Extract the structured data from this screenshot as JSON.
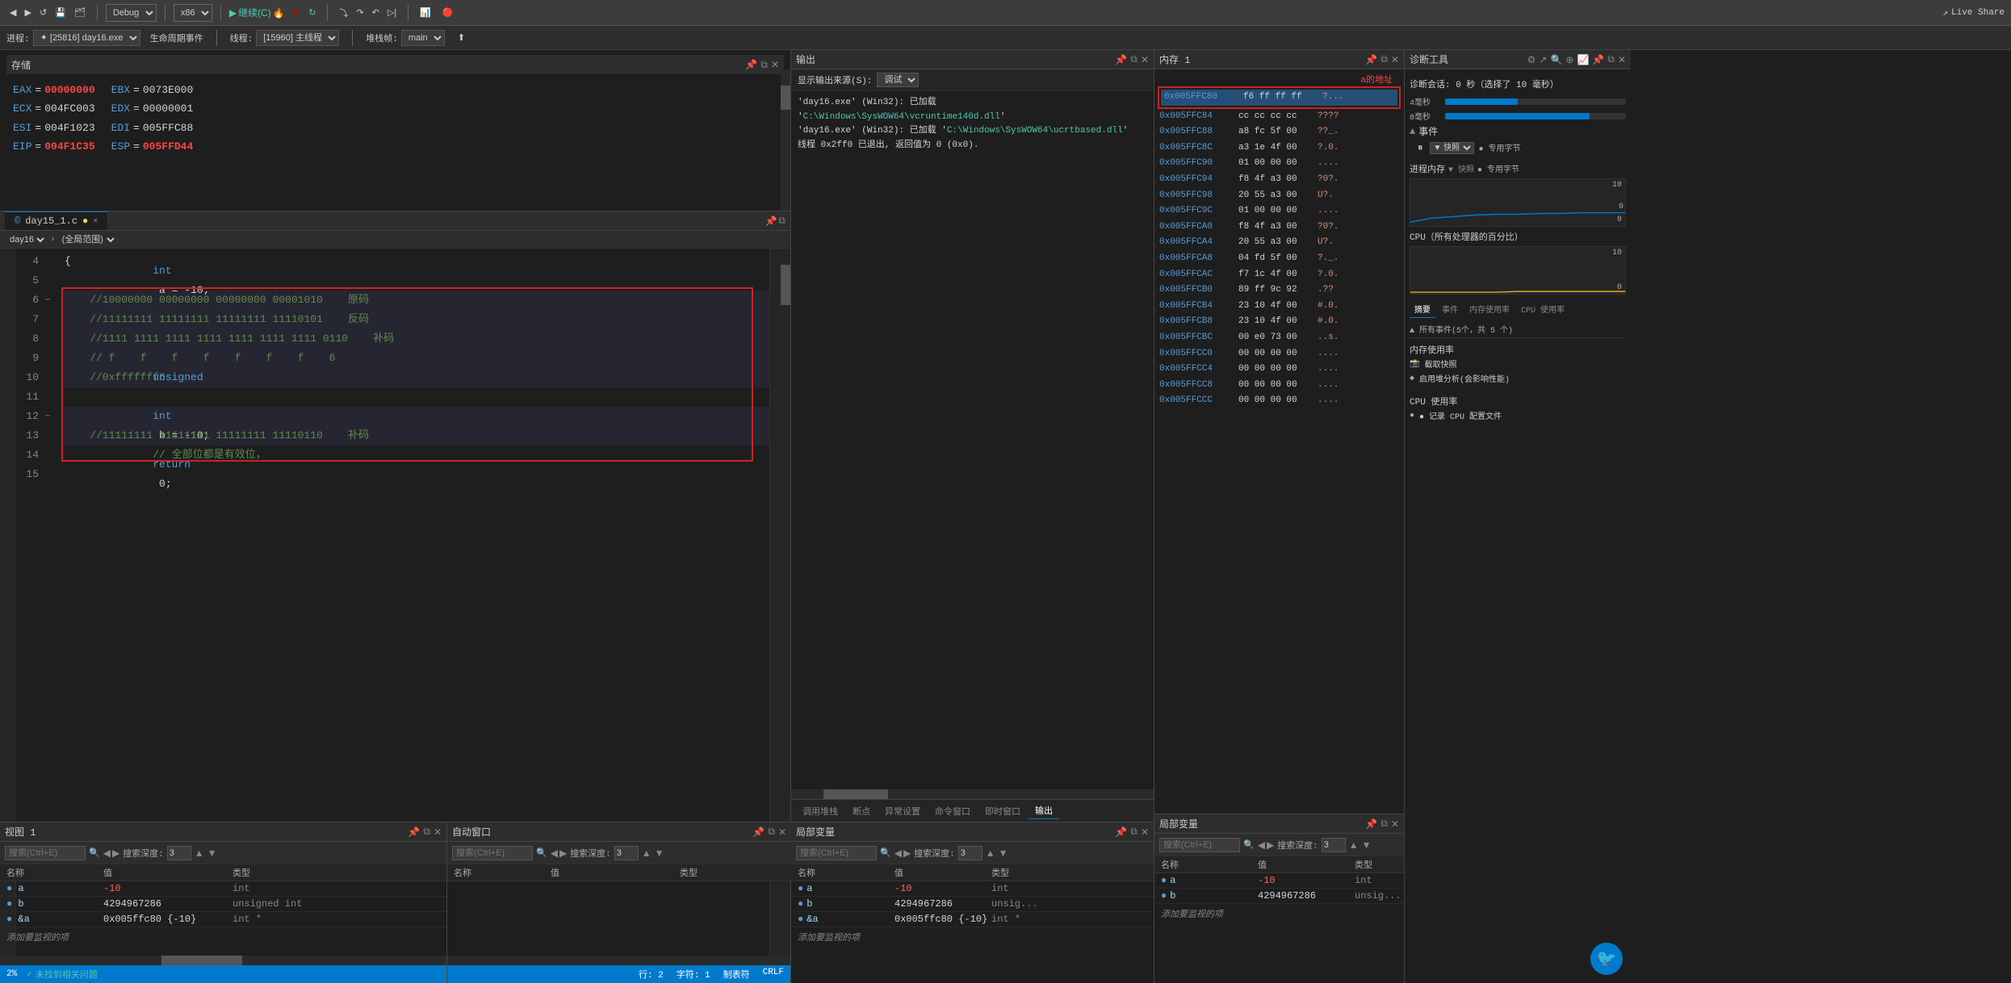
{
  "toolbar": {
    "debug_config": "Debug",
    "platform": "x86",
    "continue_label": "继续(C)",
    "live_share": "Live Share",
    "process_label": "进程:",
    "process_value": "[25816] day16.exe",
    "lifecycle_label": "生命周期事件",
    "thread_label": "线程:",
    "thread_value": "[15960] 主线程",
    "stack_label": "堆栈帧:",
    "stack_value": "main"
  },
  "registers_panel": {
    "title": "存储",
    "regs": [
      {
        "name": "EAX",
        "sep": "=",
        "value": "00000000",
        "highlight": true
      },
      {
        "name": "EBX",
        "sep": "=",
        "value": "0073E000"
      },
      {
        "name": "ECX",
        "sep": "=",
        "value": "004FC003"
      },
      {
        "name": "EDX",
        "sep": "=",
        "value": "00000001"
      },
      {
        "name": "ESI",
        "sep": "=",
        "value": "004F1023"
      },
      {
        "name": "EDI",
        "sep": "=",
        "value": "005FFC88"
      },
      {
        "name": "EIP",
        "sep": "=",
        "value": "004F1C35",
        "partial": true
      },
      {
        "name": "ESP",
        "sep": "=",
        "value": "005FFD44",
        "partial": true
      }
    ]
  },
  "editor": {
    "tab_name": "day15_1.c",
    "modified": false,
    "file_name": "day16",
    "scope": "全局范围",
    "lines": [
      {
        "num": 4,
        "text": "{",
        "indent": 0
      },
      {
        "num": 5,
        "text": "    int a = -10;",
        "indent": 0,
        "has_bp": false
      },
      {
        "num": 6,
        "text": "    //10000000 00000000 00000000 00001010    原码",
        "indent": 0,
        "is_comment": true
      },
      {
        "num": 7,
        "text": "    //11111111 11111111 11111111 11110101    反码",
        "indent": 0,
        "is_comment": true
      },
      {
        "num": 8,
        "text": "    //1111 1111 1111 1111 1111 1111 1111 0110    补码",
        "indent": 0,
        "is_comment": true
      },
      {
        "num": 9,
        "text": "    // f    f    f    f    f    f    f    6",
        "indent": 0,
        "is_comment": true
      },
      {
        "num": 10,
        "text": "    //0xfffffff6",
        "indent": 0,
        "is_comment": true
      },
      {
        "num": 11,
        "text": "",
        "indent": 0
      },
      {
        "num": 12,
        "text": "    unsigned int b = -10;// 全部位都是有效位，",
        "indent": 0,
        "is_unsigned": true
      },
      {
        "num": 13,
        "text": "    //11111111 11111111 11111111 11110110    补码",
        "indent": 0,
        "is_comment": true
      },
      {
        "num": 14,
        "text": "",
        "indent": 0
      },
      {
        "num": 15,
        "text": "    return 0;",
        "indent": 0
      }
    ],
    "status": {
      "zoom": "2%",
      "problems": "未找到相关问题",
      "line": "行: 2",
      "col": "字符: 1",
      "tab_size": "制表符",
      "encoding": "CRLF"
    }
  },
  "output_panel": {
    "title": "输出",
    "source_label": "显示输出来源(S):",
    "source_value": "调试",
    "messages": [
      "'day16.exe' (Win32): 已加载 'C:\\Windows\\SysWOW64\\vcruntime140d.dll'",
      "'day16.exe' (Win32): 已加载 'C:\\Windows\\SysWOW64\\ucrtbased.dll'",
      "线程 0x2ff0 已退出, 返回值为 0 (0x0)."
    ],
    "bottom_tabs": [
      "调用堆栈",
      "断点",
      "异常设置",
      "命令窗口",
      "即时窗口",
      "输出"
    ]
  },
  "locals_panel": {
    "title": "局部变量",
    "search_placeholder": "搜索(Ctrl+E)",
    "depth_label": "搜索深度:",
    "depth_value": "3",
    "columns": [
      "名称",
      "值",
      "类型"
    ],
    "vars": [
      {
        "icon": "●",
        "name": "a",
        "value": "-10",
        "type": "int",
        "is_red": true
      },
      {
        "icon": "●",
        "name": "b",
        "value": "4294967286",
        "type": "unsig..."
      },
      {
        "icon": "●",
        "name": "&a",
        "value": "0x005ffc80 {-10}",
        "type": "int *"
      }
    ],
    "add_label": "添加要监视的项"
  },
  "memory_panel": {
    "title": "内存 1",
    "annotation": "a的地址",
    "rows": [
      {
        "addr": "0x005FFC80",
        "bytes": "f6 ff ff ff",
        "chars": "?...",
        "selected": true
      },
      {
        "addr": "0x005FFC84",
        "bytes": "cc cc cc cc",
        "chars": "????"
      },
      {
        "addr": "0x005FFC88",
        "bytes": "a8 fc 5f 00",
        "chars": "??_."
      },
      {
        "addr": "0x005FFC8C",
        "bytes": "a3 1e 4f 00",
        "chars": "?.0."
      },
      {
        "addr": "0x005FFC90",
        "bytes": "01 00 00 00",
        "chars": "...."
      },
      {
        "addr": "0x005FFC94",
        "bytes": "f8 4f a3 00",
        "chars": "?0?."
      },
      {
        "addr": "0x005FFC98",
        "bytes": "20 55 a3 00",
        "chars": "U?."
      },
      {
        "addr": "0x005FFC9C",
        "bytes": "01 00 00 00",
        "chars": "...."
      },
      {
        "addr": "0x005FFCA0",
        "bytes": "f8 4f a3 00",
        "chars": "?0?."
      },
      {
        "addr": "0x005FFCA4",
        "bytes": "20 55 a3 00",
        "chars": "U?."
      },
      {
        "addr": "0x005FFCA8",
        "bytes": "04 fd 5f 00",
        "chars": "?._"
      },
      {
        "addr": "0x005FFCAC",
        "bytes": "f7 1c 4f 00",
        "chars": "?.0."
      },
      {
        "addr": "0x005FFCB0",
        "bytes": "89 ff 9c 92",
        "chars": ".??"
      },
      {
        "addr": "0x005FFCB4",
        "bytes": "23 10 4f 00",
        "chars": "#.0."
      },
      {
        "addr": "0x005FFCB8",
        "bytes": "23 10 4f 00",
        "chars": "#.0."
      },
      {
        "addr": "0x005FFCBC",
        "bytes": "00 e0 73 00",
        "chars": "..s."
      },
      {
        "addr": "0x005FFCC0",
        "bytes": "00 00 00 00",
        "chars": "...."
      },
      {
        "addr": "0x005FFCC4",
        "bytes": "00 00 00 00",
        "chars": "...."
      },
      {
        "addr": "0x005FFCC8",
        "bytes": "00 00 00 00",
        "chars": "...."
      },
      {
        "addr": "0x005FFCCC",
        "bytes": "00 00 00 00",
        "chars": "...."
      }
    ]
  },
  "diag_panel": {
    "title": "诊断工具",
    "session_label": "诊断会话:",
    "session_time": "0 秒（选择了 10 毫秒）",
    "time_bars": [
      {
        "label": "4毫秒",
        "value": 40
      },
      {
        "label": "8毫秒",
        "value": 80
      }
    ],
    "events_section": "▲ 事件",
    "events": {
      "pause_label": "⏸",
      "mode_label": "▼ 快照",
      "mode2_label": "● 专用字节"
    },
    "proc_mem_title": "进程内存",
    "proc_mem_value": "100",
    "proc_mem_zero": "0",
    "cpu_title": "CPU（所有处理器的百分比）",
    "cpu_value": "100",
    "cpu_zero": "0",
    "tabs": [
      "摘要",
      "事件",
      "内存使用率",
      "CPU 使用率"
    ],
    "event_section_header": "▲ 所有事件(5个，共 5 个)",
    "event_items": [
      {
        "icon": "●",
        "label": "截取快照"
      },
      {
        "icon": "◆",
        "label": "启用堆分析(会影响性能)"
      }
    ],
    "cpu_record_label": "● 记录 CPU 配置文件"
  },
  "watch_panel": {
    "title": "视图 1",
    "search_placeholder": "搜索(Ctrl+E)",
    "depth_label": "搜索深度:",
    "depth_value": "3",
    "columns": [
      "名称",
      "值",
      "类型"
    ],
    "rows": [
      {
        "icon": "●",
        "name": "a",
        "value": "-10",
        "type": "int"
      },
      {
        "icon": "●",
        "name": "b",
        "value": "4294967286",
        "type": "unsigned int"
      },
      {
        "icon": "●",
        "name": "&a",
        "value": "0x005ffc80 {-10}",
        "type": "int *"
      }
    ],
    "add_label": "添加要监视的项"
  },
  "auto_panel": {
    "title": "自动窗口",
    "search_placeholder": "搜索(Ctrl+E)",
    "depth_label": "搜索深度:",
    "depth_value": "3",
    "columns": [
      "名称",
      "值",
      "类型"
    ],
    "rows": []
  }
}
